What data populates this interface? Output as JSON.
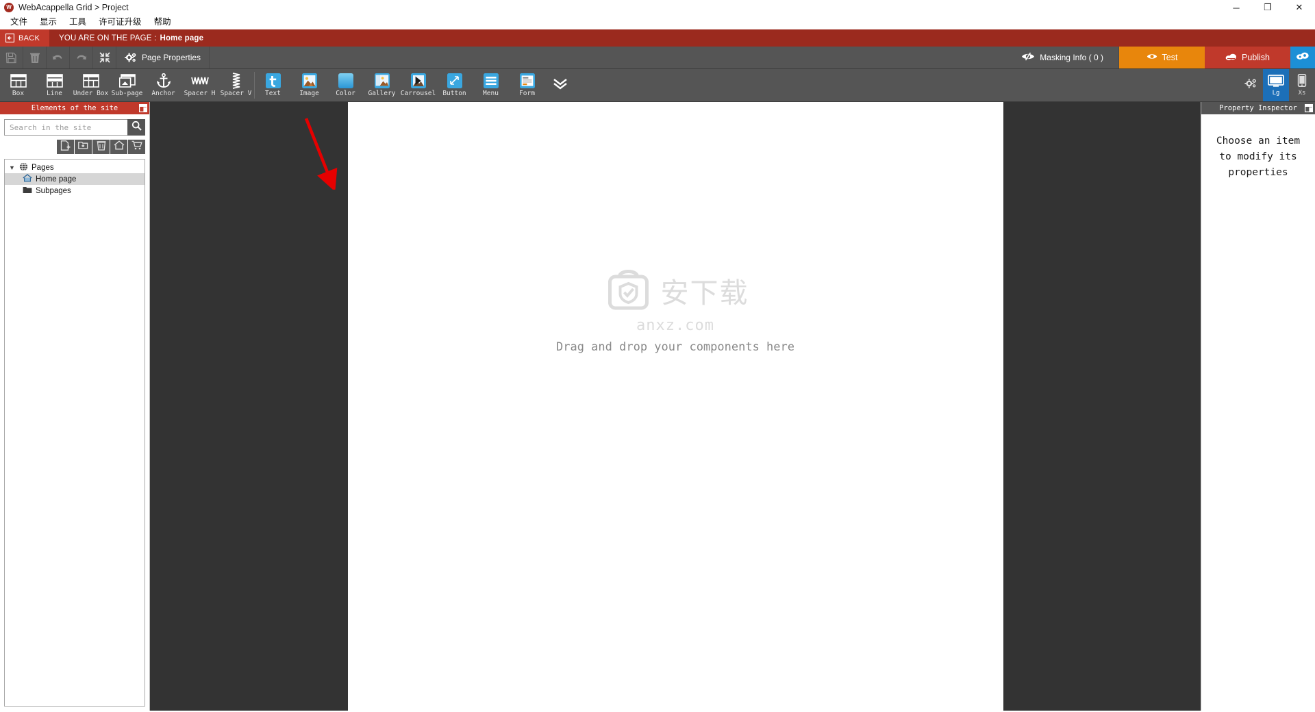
{
  "window": {
    "title": "WebAcappella Grid > Project",
    "logo_icon": "app-logo-icon",
    "minimize_label": "─",
    "maximize_label": "❐",
    "close_label": "✕"
  },
  "menubar": {
    "items": [
      {
        "label": "文件",
        "name": "menu-file"
      },
      {
        "label": "显示",
        "name": "menu-view"
      },
      {
        "label": "工具",
        "name": "menu-tools"
      },
      {
        "label": "许可证升级",
        "name": "menu-license-upgrade"
      },
      {
        "label": "帮助",
        "name": "menu-help"
      }
    ]
  },
  "backbar": {
    "back_label": "BACK",
    "page_prefix": "YOU ARE ON THE PAGE :",
    "page_name": "Home page"
  },
  "actionbar": {
    "save_label": "save-icon",
    "delete_label": "delete-icon",
    "undo_label": "undo-icon",
    "redo_label": "redo-icon",
    "collapse_label": "collapse-icon",
    "page_properties_label": "Page Properties",
    "masking_info_label": "Masking Info ( 0 )",
    "test_label": "Test",
    "publish_label": "Publish",
    "help_label": "help-icon"
  },
  "components": {
    "group1": [
      {
        "label": "Box",
        "icon": "box-icon"
      },
      {
        "label": "Line",
        "icon": "line-icon"
      },
      {
        "label": "Under Box",
        "icon": "under-box-icon"
      },
      {
        "label": "Sub-page",
        "icon": "sub-page-icon"
      },
      {
        "label": "Anchor",
        "icon": "anchor-icon"
      },
      {
        "label": "Spacer H",
        "icon": "spacer-h-icon"
      },
      {
        "label": "Spacer V",
        "icon": "spacer-v-icon"
      }
    ],
    "group2": [
      {
        "label": "Text",
        "icon": "text-icon",
        "color": "#3aa7e0"
      },
      {
        "label": "Image",
        "icon": "image-icon",
        "color": "#3aa7e0"
      },
      {
        "label": "Color",
        "icon": "color-icon",
        "color": "#3aa7e0"
      },
      {
        "label": "Gallery",
        "icon": "gallery-icon",
        "color": "#3aa7e0"
      },
      {
        "label": "Carrousel",
        "icon": "carrousel-icon",
        "color": "#3aa7e0"
      },
      {
        "label": "Button",
        "icon": "button-icon",
        "color": "#3aa7e0"
      },
      {
        "label": "Menu",
        "icon": "menu-icon",
        "color": "#3aa7e0"
      },
      {
        "label": "Form",
        "icon": "form-icon",
        "color": "#3aa7e0"
      }
    ],
    "expand_icon": "chevron-double-down-icon",
    "settings_icon": "gear-settings-icon",
    "devices": [
      {
        "label": "Lg",
        "icon": "desktop-icon",
        "active": true
      },
      {
        "label": "Xs",
        "icon": "mobile-icon",
        "active": false
      }
    ]
  },
  "left_panel": {
    "title": "Elements of the site",
    "dock_icon": "dock-panel-icon",
    "search": {
      "placeholder": "Search in the site",
      "value": "",
      "button_icon": "search-icon"
    },
    "tools": [
      {
        "name": "add-page-button",
        "icon": "add-page-icon"
      },
      {
        "name": "add-folder-button",
        "icon": "add-folder-icon"
      },
      {
        "name": "delete-button",
        "icon": "trash-icon"
      },
      {
        "name": "set-home-button",
        "icon": "home-icon"
      },
      {
        "name": "shop-button",
        "icon": "cart-icon"
      }
    ],
    "tree": [
      {
        "label": "Pages",
        "icon": "globe-icon",
        "level": 0,
        "expanded": true,
        "selected": false
      },
      {
        "label": "Home page",
        "icon": "home-page-icon",
        "level": 1,
        "selected": true
      },
      {
        "label": "Subpages",
        "icon": "folder-icon",
        "level": 1,
        "selected": false
      }
    ]
  },
  "canvas": {
    "drop_hint": "Drag and drop your components here",
    "watermark_cn": "安下载",
    "watermark_url": "anxz.com",
    "watermark_icon": "shield-bag-icon",
    "arrow_icon": "red-arrow-annotation"
  },
  "right_panel": {
    "title": "Property Inspector",
    "dock_icon": "dock-panel-icon",
    "empty_message": "Choose an item to modify its properties"
  },
  "colors": {
    "accent_red": "#c0392b",
    "dark_red": "#9b2a1e",
    "toolbar_gray": "#555555",
    "canvas_dark": "#333333",
    "orange": "#e8860c",
    "blue": "#1c8fd6",
    "device_active": "#1c6fb8"
  }
}
